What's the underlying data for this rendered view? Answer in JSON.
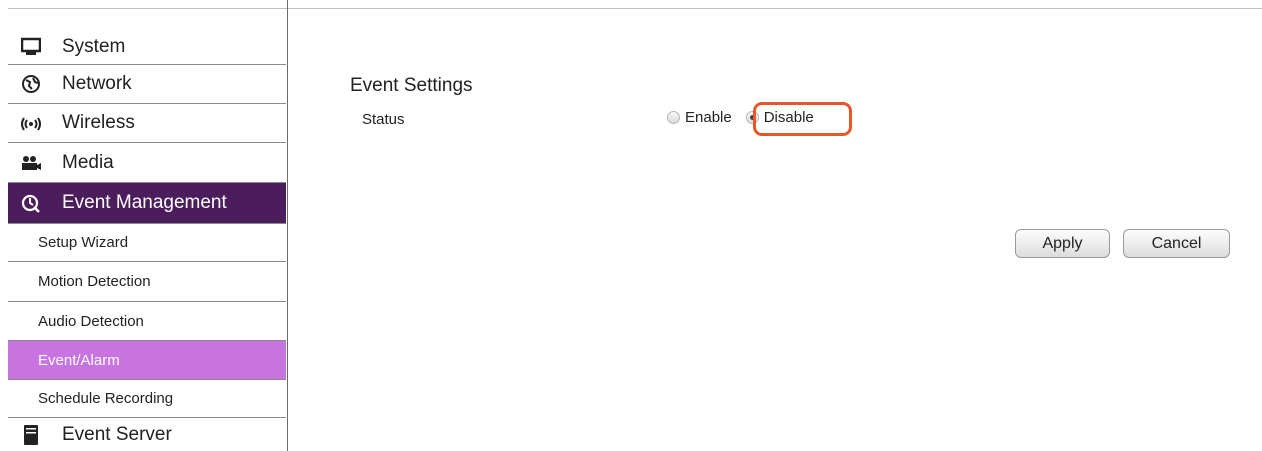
{
  "sidebar": {
    "items": [
      {
        "label": "System",
        "icon": "monitor-icon"
      },
      {
        "label": "Network",
        "icon": "globe-icon"
      },
      {
        "label": "Wireless",
        "icon": "wireless-icon"
      },
      {
        "label": "Media",
        "icon": "media-icon"
      },
      {
        "label": "Event Management",
        "icon": "event-management-icon",
        "active": true
      }
    ],
    "subitems": [
      {
        "label": "Setup Wizard"
      },
      {
        "label": "Motion Detection"
      },
      {
        "label": "Audio Detection"
      },
      {
        "label": "Event/Alarm",
        "selected": true
      },
      {
        "label": "Schedule Recording"
      }
    ],
    "event_server": {
      "label": "Event Server",
      "icon": "server-icon"
    }
  },
  "main": {
    "section_title": "Event Settings",
    "status_label": "Status",
    "radio_options": [
      "Enable",
      "Disable"
    ],
    "selected_option": "Disable",
    "apply_label": "Apply",
    "cancel_label": "Cancel"
  },
  "colors": {
    "active_bg": "#4c1d5d",
    "selected_bg": "#c874e0",
    "highlight": "#e8552a"
  }
}
